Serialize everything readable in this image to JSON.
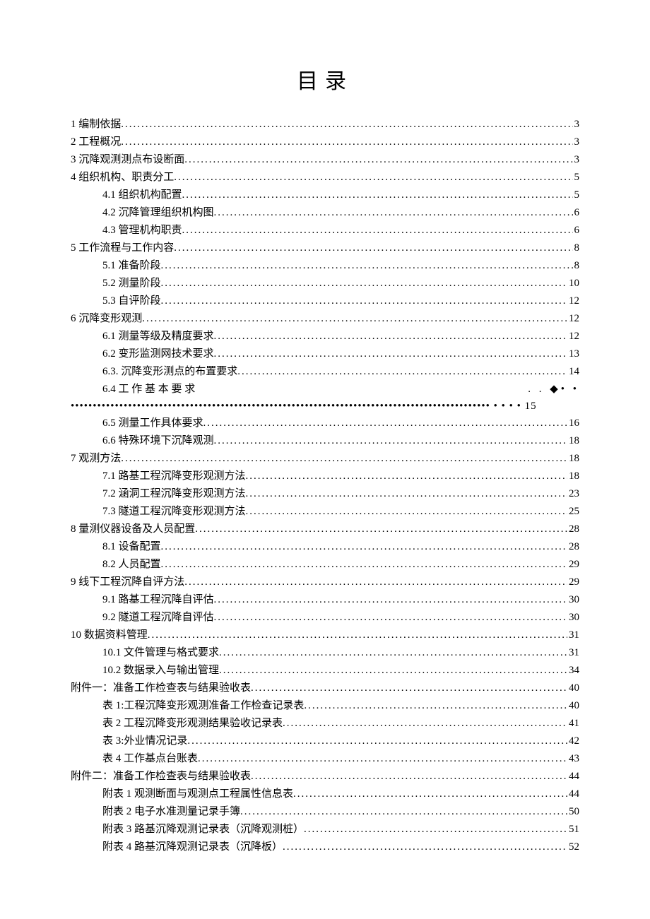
{
  "title": "目录",
  "entries": [
    {
      "level": 1,
      "text": "1 编制依据",
      "page": "3"
    },
    {
      "level": 1,
      "text": "2 工程概况",
      "page": "3"
    },
    {
      "level": 1,
      "text": "3 沉降观测测点布设断面",
      "page": "3"
    },
    {
      "level": 1,
      "text": "4 组织机构、职责分工",
      "page": "5"
    },
    {
      "level": 2,
      "text": "4.1  组织机构配置",
      "page": "5"
    },
    {
      "level": 2,
      "text": "4.2  沉降管理组织机构图",
      "page": "6"
    },
    {
      "level": 2,
      "text": "4.3  管理机构职责",
      "page": "6"
    },
    {
      "level": 1,
      "text": "5 工作流程与工作内容",
      "page": "8"
    },
    {
      "level": 2,
      "text": "5.1  准备阶段",
      "page": "8"
    },
    {
      "level": 2,
      "text": "5.2  测量阶段",
      "page": "10"
    },
    {
      "level": 2,
      "text": "5.3  自评阶段",
      "page": "12"
    },
    {
      "level": 1,
      "text": "6 沉降变形观测",
      "page": "12"
    },
    {
      "level": 2,
      "text": "6.1  测量等级及精度要求",
      "page": "12"
    },
    {
      "level": 2,
      "text": "6.2  变形监测网技术要求",
      "page": "13"
    },
    {
      "level": 2,
      "text": "6.3. 沉降变形测点的布置要求",
      "page": "14"
    },
    {
      "level": 0,
      "special": "64",
      "label": "6.4    工    作    基    本    要    求",
      "tail": ". . ◆•    •",
      "row2_text": "••••••••••••••••••••••••••••••••••••••••••••••••••••••••••••••••••••••••••••••••••••••••••••••• • • • • 15"
    },
    {
      "level": 2,
      "text": "6.5  测量工作具体要求",
      "page": "16"
    },
    {
      "level": 2,
      "text": "6.6  特殊环境下沉降观测",
      "page": "18"
    },
    {
      "level": 1,
      "text": "7 观测方法",
      "page": "18"
    },
    {
      "level": 2,
      "text": "7.1 路基工程沉降变形观测方法",
      "page": "18"
    },
    {
      "level": 2,
      "text": "7.2 涵洞工程沉降变形观测方法",
      "page": "23"
    },
    {
      "level": 2,
      "text": "7.3 隧道工程沉降变形观测方法",
      "page": "25"
    },
    {
      "level": 1,
      "text": "8 量测仪器设备及人员配置",
      "page": "28"
    },
    {
      "level": 2,
      "text": "8.1  设备配置",
      "page": "28"
    },
    {
      "level": 2,
      "text": "8.2  人员配置",
      "page": "29"
    },
    {
      "level": 1,
      "text": "9 线下工程沉降自评方法",
      "page": "29"
    },
    {
      "level": 2,
      "text": "9.1  路基工程沉降自评估",
      "page": "30"
    },
    {
      "level": 2,
      "text": "9.2  隧道工程沉降自评估",
      "page": "30"
    },
    {
      "level": 1,
      "text": "10 数据资料管理",
      "page": "31"
    },
    {
      "level": 2,
      "text": "10.1 文件管理与格式要求",
      "page": "31"
    },
    {
      "level": 2,
      "text": "10.2 数据录入与输出管理",
      "page": "34"
    },
    {
      "level": 1,
      "text": "附件一：准备工作检查表与结果验收表",
      "page": "40"
    },
    {
      "level": 2,
      "text": "表 1:工程沉降变形观测准备工作检查记录表",
      "page": "40"
    },
    {
      "level": 2,
      "text": "表 2 工程沉降变形观测结果验收记录表",
      "page": "41"
    },
    {
      "level": 2,
      "text": "表 3:外业情况记录",
      "page": "42"
    },
    {
      "level": 2,
      "text": "表 4 工作基点台账表",
      "page": "43"
    },
    {
      "level": 1,
      "text": "附件二：准备工作检查表与结果验收表",
      "page": "44"
    },
    {
      "level": 2,
      "text": "附表 1 观测断面与观测点工程属性信息表",
      "page": "44"
    },
    {
      "level": 2,
      "text": "附表 2 电子水准测量记录手簿",
      "page": "50"
    },
    {
      "level": 2,
      "text": "附表 3 路基沉降观测记录表（沉降观测桩）",
      "page": "51"
    },
    {
      "level": 2,
      "text": "附表 4 路基沉降观测记录表（沉降板）",
      "page": "52"
    }
  ]
}
